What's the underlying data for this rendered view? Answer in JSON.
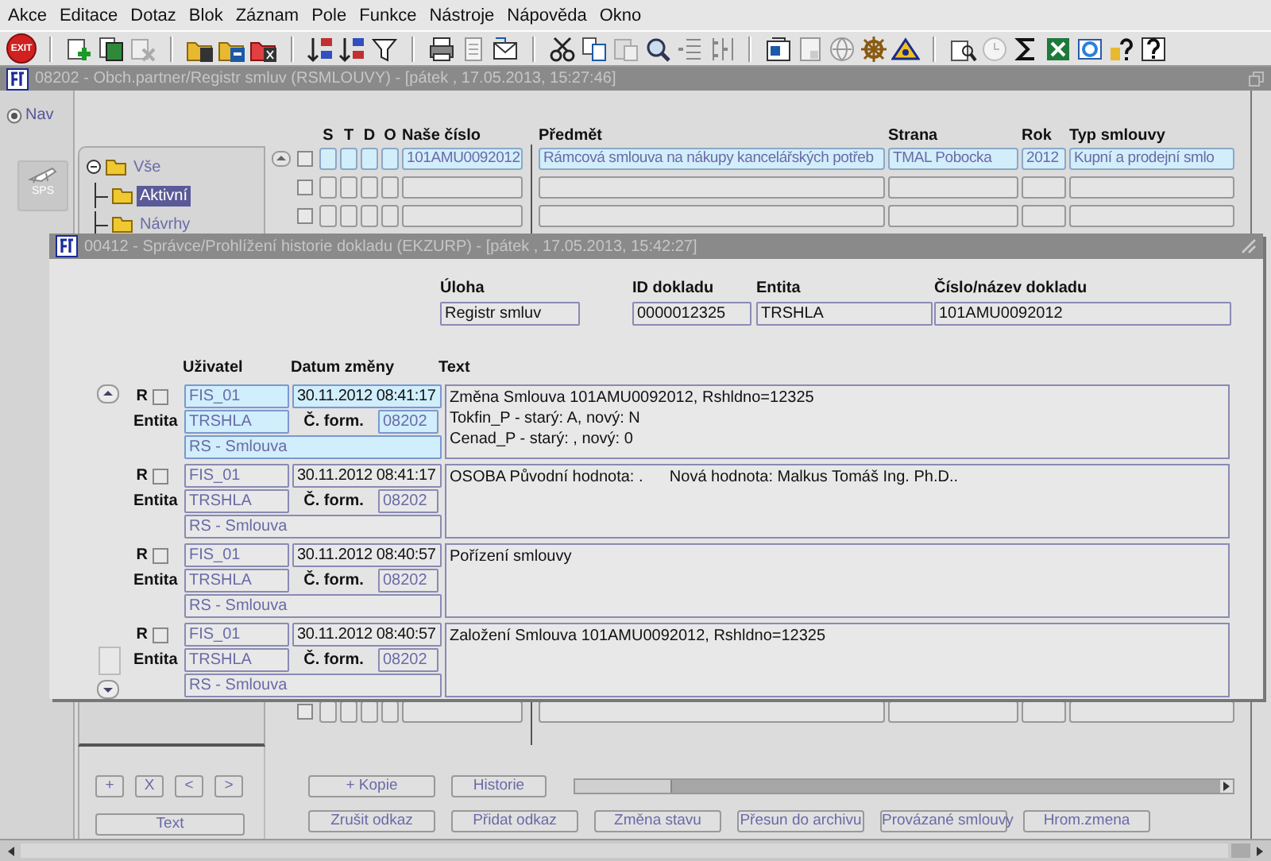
{
  "menu": [
    {
      "label": "Akce"
    },
    {
      "label": "Editace"
    },
    {
      "label": "Dotaz"
    },
    {
      "label": "Blok"
    },
    {
      "label": "Záznam"
    },
    {
      "label": "Pole"
    },
    {
      "label": "Funkce"
    },
    {
      "label": "Nástroje"
    },
    {
      "label": "Nápověda"
    },
    {
      "label": "Okno"
    }
  ],
  "toolbar": {
    "exit_label": "EXIT"
  },
  "main_window": {
    "title": "08202 - Obch.partner/Registr smluv (RSMLOUVY) - [pátek , 17.05.2013, 15:27:46]",
    "nav": {
      "label": "Nav",
      "selected": true
    },
    "sps_label": "SPS",
    "tree": [
      {
        "label": "Vše",
        "expanded": true,
        "selected": false,
        "children": [
          {
            "label": "Aktivní",
            "selected": true
          },
          {
            "label": "Návrhy",
            "selected": false
          }
        ]
      }
    ],
    "table": {
      "columns": [
        "S",
        "T",
        "D",
        "O",
        "Naše číslo",
        "Předmět",
        "Strana",
        "Rok",
        "Typ smlouvy"
      ],
      "rows": [
        {
          "selected": true,
          "checked": false,
          "number": "101AMU0092012",
          "subject": "Rámcová smlouva na nákupy kancelářských potřeb",
          "party": "TMAL Pobocka",
          "year": "2012",
          "type": "Kupní a prodejní smlo"
        },
        {
          "selected": false,
          "checked": false
        },
        {
          "selected": false,
          "checked": false
        },
        {
          "selected": false,
          "checked": false
        }
      ]
    },
    "nav_buttons": [
      "+",
      "X",
      "<",
      ">"
    ],
    "text_button": "Text",
    "action_buttons": [
      "+ Kopie",
      "Historie"
    ],
    "bottom_buttons": [
      "Zrušit odkaz",
      "Přidat odkaz",
      "Změna stavu",
      "Přesun do archivu",
      "Provázané smlouvy",
      "Hrom.zmena"
    ]
  },
  "dialog": {
    "title": "00412 - Správce/Prohlížení historie dokladu (EKZURP) - [pátek , 17.05.2013, 15:42:27]",
    "header": [
      {
        "label": "Úloha",
        "value": "Registr smluv"
      },
      {
        "label": "ID dokladu",
        "value": "0000012325"
      },
      {
        "label": "Entita",
        "value": "TRSHLA"
      },
      {
        "label": "Číslo/název dokladu",
        "value": "101AMU0092012"
      }
    ],
    "columns": [
      "Uživatel",
      "Datum změny",
      "Text"
    ],
    "records": [
      {
        "selected": true,
        "r_label": "R",
        "checked": false,
        "user": "FIS_01",
        "date": "30.11.2012 08:41:17",
        "entity_label": "Entita",
        "entity": "TRSHLA",
        "form_label": "Č. form.",
        "form": "08202",
        "module": "RS - Smlouva",
        "text": [
          "Změna Smlouva 101AMU0092012, Rshldno=12325",
          "Tokfin_P - starý: A, nový: N",
          "Cenad_P - starý: , nový: 0"
        ]
      },
      {
        "selected": false,
        "r_label": "R",
        "checked": false,
        "user": "FIS_01",
        "date": "30.11.2012 08:41:17",
        "entity_label": "Entita",
        "entity": "TRSHLA",
        "form_label": "Č. form.",
        "form": "08202",
        "module": "RS - Smlouva",
        "text": [
          "OSOBA Původní hodnota: .      Nová hodnota: Malkus Tomáš Ing. Ph.D.."
        ]
      },
      {
        "selected": false,
        "r_label": "R",
        "checked": false,
        "user": "FIS_01",
        "date": "30.11.2012 08:40:57",
        "entity_label": "Entita",
        "entity": "TRSHLA",
        "form_label": "Č. form.",
        "form": "08202",
        "module": "RS - Smlouva",
        "text": [
          "Pořízení smlouvy"
        ]
      },
      {
        "selected": false,
        "r_label": "R",
        "checked": false,
        "user": "FIS_01",
        "date": "30.11.2012 08:40:57",
        "entity_label": "Entita",
        "entity": "TRSHLA",
        "form_label": "Č. form.",
        "form": "08202",
        "module": "RS - Smlouva",
        "text": [
          "Založení Smlouva 101AMU0092012, Rshldno=12325"
        ]
      }
    ]
  }
}
